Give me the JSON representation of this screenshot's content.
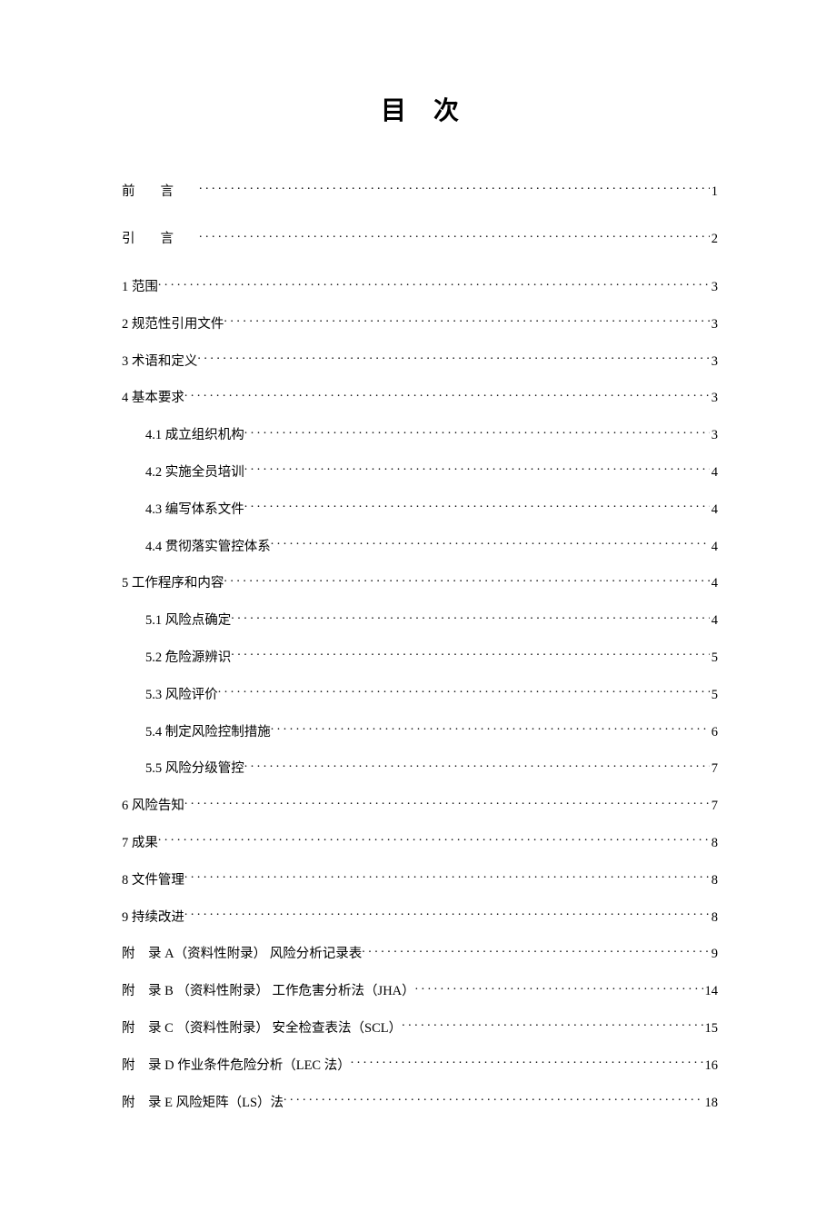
{
  "title": "目次",
  "toc": [
    {
      "label": "前",
      "label2": "言",
      "page": "1",
      "indent": 0,
      "front": true
    },
    {
      "label": "引",
      "label2": "言",
      "page": "2",
      "indent": 0,
      "front": true
    },
    {
      "label": "1 范围",
      "page": "3",
      "indent": 0
    },
    {
      "label": "2 规范性引用文件",
      "page": "3",
      "indent": 0
    },
    {
      "label": "3 术语和定义",
      "page": "3",
      "indent": 0
    },
    {
      "label": "4 基本要求",
      "page": "3",
      "indent": 0
    },
    {
      "label": "4.1 成立组织机构",
      "page": "3",
      "indent": 1
    },
    {
      "label": "4.2 实施全员培训",
      "page": "4",
      "indent": 1
    },
    {
      "label": "4.3 编写体系文件",
      "page": "4",
      "indent": 1
    },
    {
      "label": "4.4 贯彻落实管控体系",
      "page": "4",
      "indent": 1
    },
    {
      "label": "5 工作程序和内容",
      "page": "4",
      "indent": 0
    },
    {
      "label": "5.1 风险点确定",
      "page": "4",
      "indent": 1
    },
    {
      "label": "5.2 危险源辨识",
      "page": "5",
      "indent": 1
    },
    {
      "label": "5.3 风险评价",
      "page": "5",
      "indent": 1
    },
    {
      "label": "5.4 制定风险控制措施",
      "page": "6",
      "indent": 1
    },
    {
      "label": "5.5 风险分级管控",
      "page": "7",
      "indent": 1
    },
    {
      "label": "6 风险告知",
      "page": "7",
      "indent": 0
    },
    {
      "label": "7 成果",
      "page": "8",
      "indent": 0
    },
    {
      "label": "8 文件管理",
      "page": "8",
      "indent": 0
    },
    {
      "label": "9 持续改进",
      "page": "8",
      "indent": 0
    },
    {
      "label": "附　录 A（资料性附录） 风险分析记录表",
      "page": "9",
      "indent": 0
    },
    {
      "label": "附　录 B （资料性附录） 工作危害分析法（JHA）",
      "page": "14",
      "indent": 0
    },
    {
      "label": "附　录 C （资料性附录） 安全检查表法（SCL）",
      "page": "15",
      "indent": 0
    },
    {
      "label": "附　录 D 作业条件危险分析（LEC 法）",
      "page": "16",
      "indent": 0
    },
    {
      "label": "附　录 E 风险矩阵（LS）法",
      "page": "18",
      "indent": 0
    }
  ]
}
